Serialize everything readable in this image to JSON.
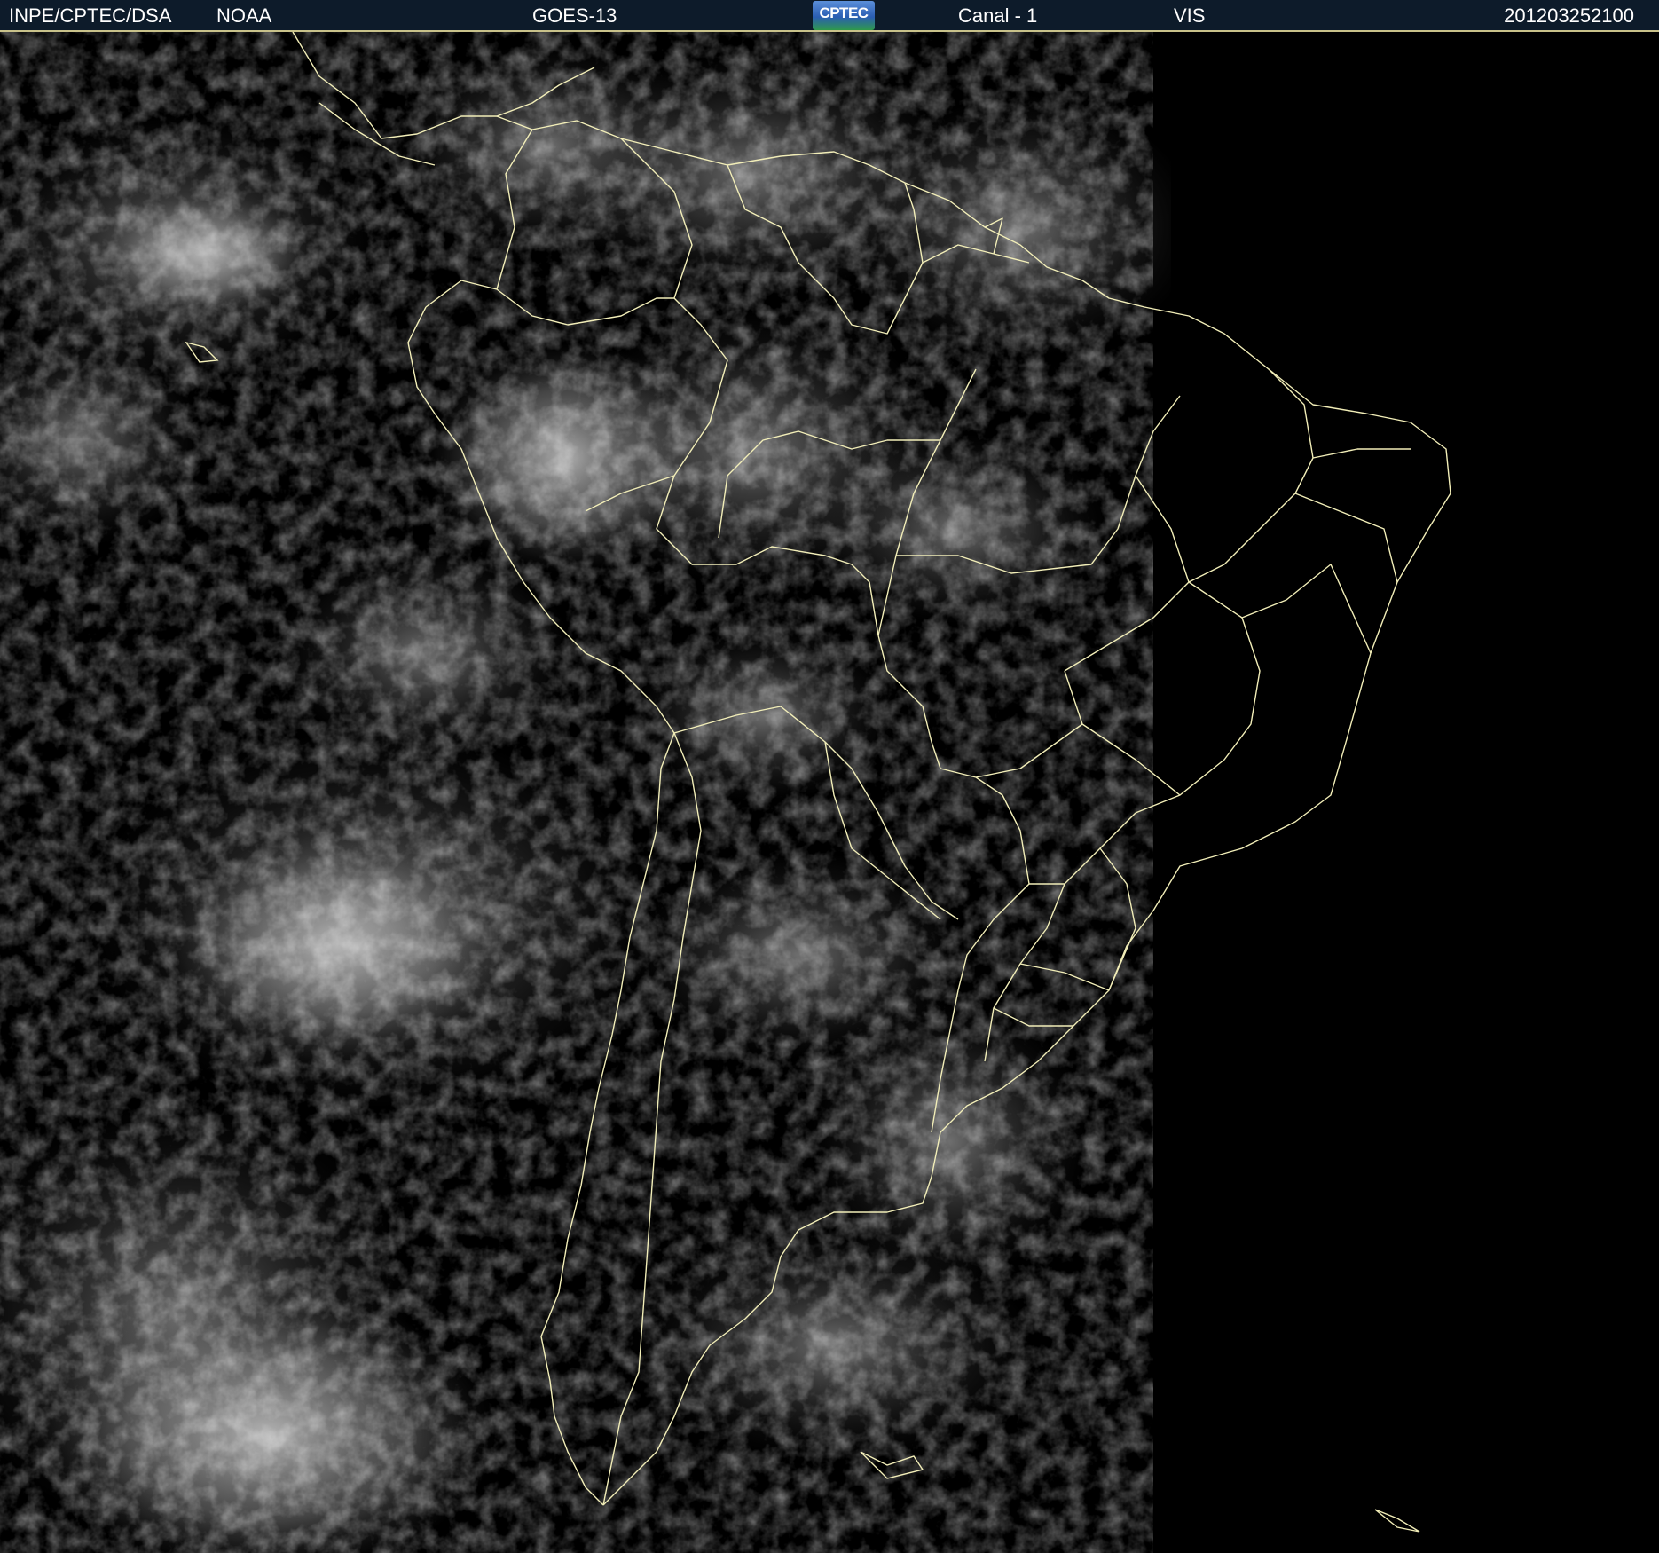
{
  "header": {
    "organization": "INPE/CPTEC/DSA",
    "agency": "NOAA",
    "satellite": "GOES-13",
    "logo_text": "CPTEC",
    "channel": "Canal - 1",
    "band": "VIS",
    "timestamp": "201203252100"
  },
  "colors": {
    "header_bg": "#0d1b2a",
    "header_text": "#ffffff",
    "border_lines": "#f2eeb8",
    "space_bg": "#000000",
    "cloud_bright": "#c8c8c8",
    "cloud_dim": "#3a3a3a"
  },
  "image": {
    "subject": "satellite visible-channel image of South America",
    "overlay": "country and state borders"
  }
}
